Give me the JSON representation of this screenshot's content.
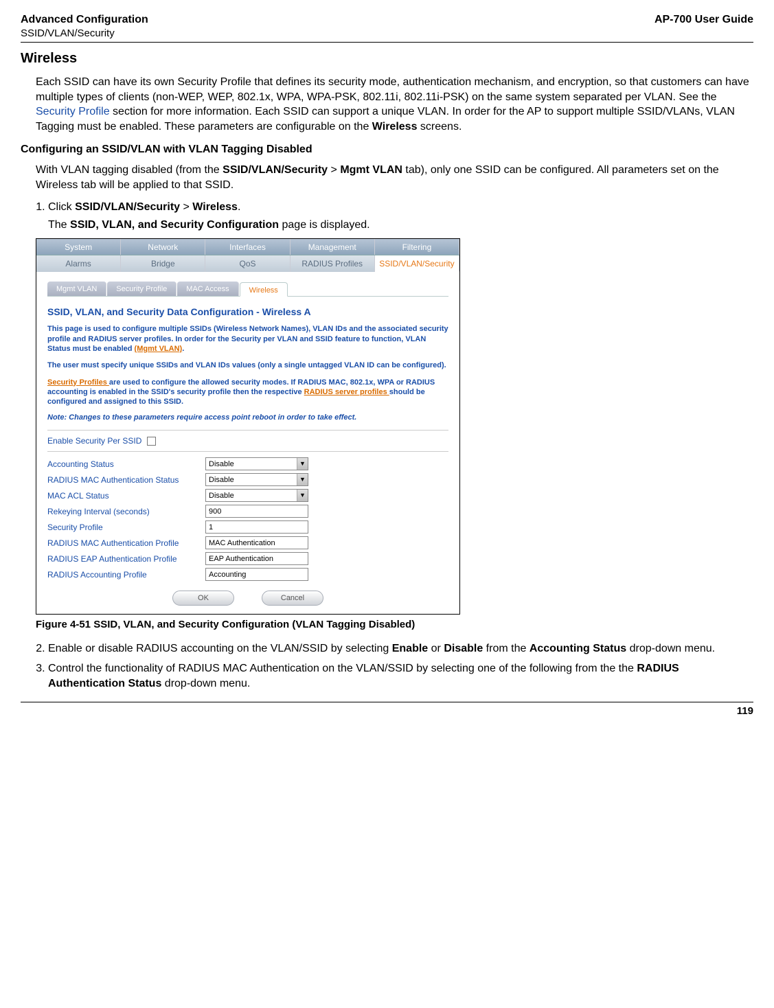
{
  "header": {
    "left_title": "Advanced Configuration",
    "left_sub": "SSID/VLAN/Security",
    "right": "AP-700 User Guide"
  },
  "section_title": "Wireless",
  "intro_text_pre": "Each SSID can have its own Security Profile that defines its security mode, authentication mechanism, and encryption, so that customers can have multiple types of clients (non-WEP, WEP, 802.1x, WPA, WPA-PSK, 802.11i, 802.11i-PSK) on the same system separated per VLAN. See the ",
  "intro_link": "Security Profile",
  "intro_text_post": " section for more information. Each SSID can support a unique VLAN. In order for the AP to support multiple SSID/VLANs, VLAN Tagging must be enabled. These parameters are configurable on the ",
  "intro_bold": "Wireless",
  "intro_tail": " screens.",
  "subsection_title": "Configuring an SSID/VLAN with VLAN Tagging Disabled",
  "subsection_text_1_pre": "With VLAN tagging disabled (from the ",
  "subsection_text_1_b1": "SSID/VLAN/Security",
  "subsection_text_1_mid1": " > ",
  "subsection_text_1_b2": "Mgmt VLAN",
  "subsection_text_1_post": " tab), only one SSID can be configured. All parameters set on the Wireless tab will be applied to that SSID.",
  "step1_pre": "Click ",
  "step1_b1": "SSID/VLAN/Security",
  "step1_mid": " > ",
  "step1_b2": "Wireless",
  "step1_tail": ".",
  "step1_sub_pre": "The ",
  "step1_sub_b": "SSID, VLAN, and Security Configuration",
  "step1_sub_post": " page is displayed.",
  "figure_caption": "Figure 4-51 SSID, VLAN, and Security Configuration (VLAN Tagging Disabled)",
  "step2_pre": "Enable or disable RADIUS accounting on the VLAN/SSID by selecting ",
  "step2_b1": "Enable",
  "step2_mid1": " or ",
  "step2_b2": "Disable",
  "step2_mid2": " from the ",
  "step2_b3": "Accounting Status",
  "step2_post": " drop-down menu.",
  "step3_pre": "Control the functionality of RADIUS MAC Authentication on the VLAN/SSID by selecting one of the following from the the ",
  "step3_b1": "RADIUS Authentication Status",
  "step3_post": " drop-down menu.",
  "screenshot": {
    "tabs_row1": [
      "System",
      "Network",
      "Interfaces",
      "Management",
      "Filtering"
    ],
    "tabs_row2": [
      "Alarms",
      "Bridge",
      "QoS",
      "RADIUS Profiles",
      "SSID/VLAN/Security"
    ],
    "subtabs": [
      "Mgmt VLAN",
      "Security Profile",
      "MAC Access",
      "Wireless"
    ],
    "panel_title": "SSID, VLAN, and Security Data Configuration - Wireless A",
    "desc1_pre": "This page is used to configure multiple SSIDs (Wireless Network Names), VLAN IDs and the associated security profile and RADIUS server profiles. In order for the Security per VLAN and SSID feature to function, VLAN Status must be enabled ",
    "desc1_link": "(Mgmt VLAN)",
    "desc1_post": ".",
    "desc2": "The user must specify unique SSIDs and VLAN IDs values (only a single untagged VLAN ID can be configured).",
    "desc3_link1": "Security Profiles ",
    "desc3_mid": "are used to configure the allowed security modes. If RADIUS MAC, 802.1x, WPA or RADIUS accounting is enabled in the SSID's security profile then the respective ",
    "desc3_link2": "RADIUS server profiles ",
    "desc3_post": "should be configured and assigned to this SSID.",
    "note": "Note: Changes to these parameters require access point reboot in order to take effect.",
    "enable_label": "Enable Security Per SSID",
    "fields": [
      {
        "label": "Accounting Status",
        "type": "select",
        "value": "Disable"
      },
      {
        "label": "RADIUS MAC Authentication Status",
        "type": "select",
        "value": "Disable"
      },
      {
        "label": "MAC ACL Status",
        "type": "select",
        "value": "Disable"
      },
      {
        "label": "Rekeying Interval (seconds)",
        "type": "text",
        "value": "900"
      },
      {
        "label": "Security Profile",
        "type": "text",
        "value": "1"
      },
      {
        "label": "RADIUS MAC Authentication Profile",
        "type": "text",
        "value": "MAC Authentication"
      },
      {
        "label": "RADIUS EAP Authentication Profile",
        "type": "text",
        "value": "EAP Authentication"
      },
      {
        "label": "RADIUS Accounting Profile",
        "type": "text",
        "value": "Accounting"
      }
    ],
    "buttons": {
      "ok": "OK",
      "cancel": "Cancel"
    }
  },
  "page_number": "119"
}
